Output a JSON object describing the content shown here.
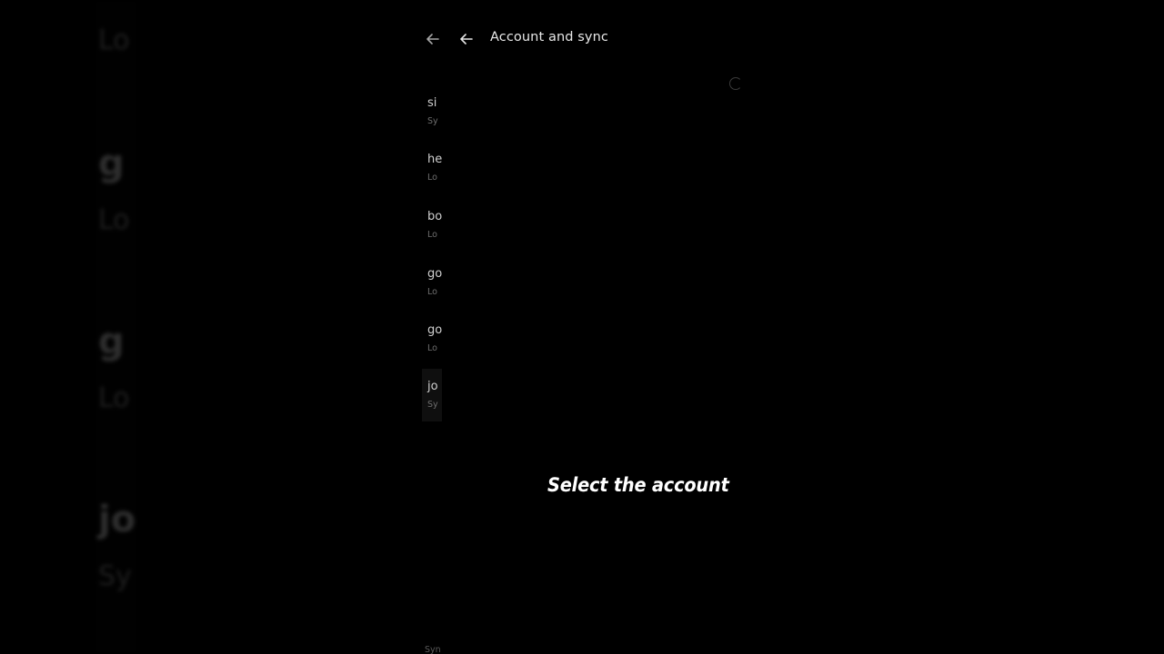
{
  "background_preview": {
    "items": [
      {
        "title": "",
        "sub": "Lo"
      },
      {
        "title": "g",
        "sub": "Lo"
      },
      {
        "title": "g",
        "sub": "Lo"
      },
      {
        "title": "jo",
        "sub": "Sy"
      }
    ]
  },
  "appbar": {
    "title": "Account and sync"
  },
  "accounts": [
    {
      "name": "si",
      "sub": "Sy"
    },
    {
      "name": "he",
      "sub": "Lo"
    },
    {
      "name": "bo",
      "sub": "Lo"
    },
    {
      "name": "go",
      "sub": "Lo"
    },
    {
      "name": "go",
      "sub": "Lo"
    },
    {
      "name": "jo",
      "sub": "Sy"
    }
  ],
  "footer": {
    "sub": "Syn"
  },
  "caption": {
    "text": "Select the account"
  },
  "colors": {
    "background": "#000000",
    "caption": "#ffffff",
    "title": "#e8e8e8"
  }
}
